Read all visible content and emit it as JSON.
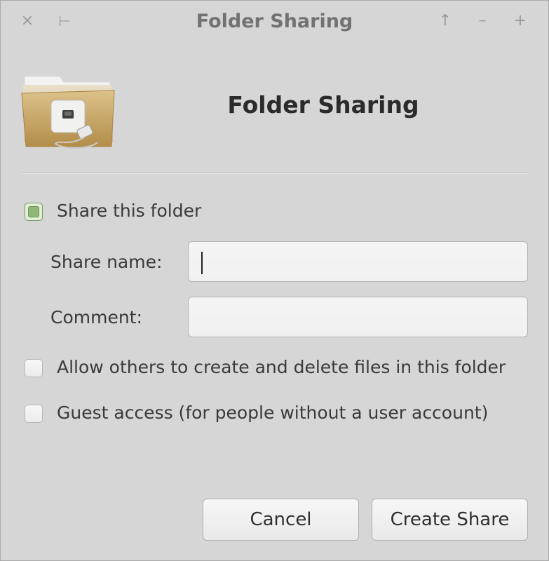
{
  "window": {
    "title": "Folder Sharing",
    "controls": {
      "close": "×",
      "menu": "⊢",
      "up": "↑",
      "minimize": "–",
      "maximize": "+"
    }
  },
  "header": {
    "title": "Folder Sharing",
    "icon": "shared-folder-icon"
  },
  "form": {
    "share_this_folder": {
      "label": "Share this folder",
      "checked": true
    },
    "share_name": {
      "label": "Share name:",
      "value": ""
    },
    "comment": {
      "label": "Comment:",
      "value": ""
    },
    "allow_others": {
      "label": "Allow others to create and delete files in this folder",
      "checked": false
    },
    "guest_access": {
      "label": "Guest access (for people without a user account)",
      "checked": false
    }
  },
  "buttons": {
    "cancel": "Cancel",
    "create_share": "Create Share"
  },
  "colors": {
    "window_bg": "#d6d6d6",
    "checked_accent": "#8fb877"
  }
}
